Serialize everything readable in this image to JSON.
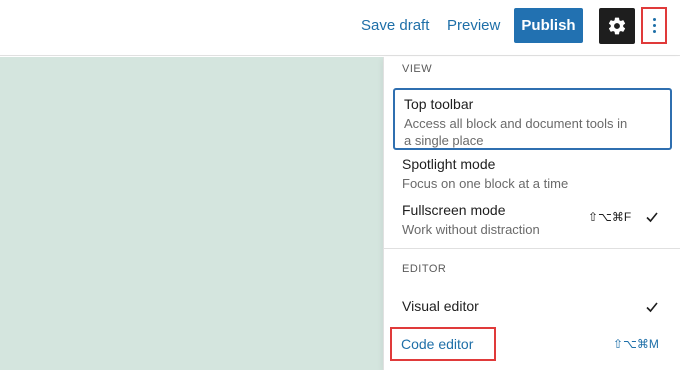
{
  "toolbar": {
    "save_draft": "Save draft",
    "preview": "Preview",
    "publish": "Publish",
    "publish_color": "#2271b1"
  },
  "menu": {
    "view_section": "VIEW",
    "editor_section": "EDITOR",
    "top_toolbar": {
      "title": "Top toolbar",
      "description": "Access all block and document tools in a single place"
    },
    "spotlight": {
      "title": "Spotlight mode",
      "description": "Focus on one block at a time"
    },
    "fullscreen": {
      "title": "Fullscreen mode",
      "description": "Work without distraction",
      "shortcut": "⇧⌥⌘F",
      "checked": true
    },
    "visual_editor": {
      "title": "Visual editor",
      "checked": true
    },
    "code_editor": {
      "title": "Code editor",
      "shortcut": "⇧⌥⌘M"
    }
  },
  "colors": {
    "canvas": "#d4e5de",
    "highlight_border": "#e03a3a",
    "link": "#1e6fa8"
  }
}
